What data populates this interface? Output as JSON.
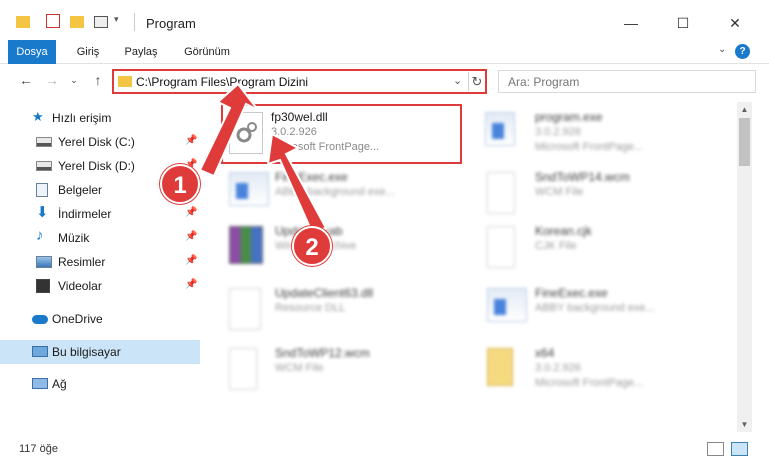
{
  "window": {
    "title": "Program"
  },
  "ribbon": {
    "tabs": [
      "Dosya",
      "Giriş",
      "Paylaş",
      "Görünüm"
    ]
  },
  "address": {
    "path": "C:\\Program Files\\Program Dizini"
  },
  "search": {
    "placeholder": "Ara: Program"
  },
  "sidebar": {
    "items": [
      {
        "label": "Hızlı erişim",
        "icon": "star-icon"
      },
      {
        "label": "Yerel Disk (C:)",
        "icon": "drive-icon",
        "pinned": true
      },
      {
        "label": "Yerel Disk (D:)",
        "icon": "drive-icon",
        "pinned": true
      },
      {
        "label": "Belgeler",
        "icon": "documents-icon",
        "pinned": true
      },
      {
        "label": "İndirmeler",
        "icon": "download-icon",
        "pinned": true
      },
      {
        "label": "Müzik",
        "icon": "music-icon",
        "pinned": true
      },
      {
        "label": "Resimler",
        "icon": "pictures-icon",
        "pinned": true
      },
      {
        "label": "Videolar",
        "icon": "video-icon",
        "pinned": true
      },
      {
        "label": "OneDrive",
        "icon": "cloud-icon"
      },
      {
        "label": "Bu bilgisayar",
        "icon": "computer-icon"
      },
      {
        "label": "Ağ",
        "icon": "network-icon"
      }
    ]
  },
  "files": [
    {
      "name": "fp30wel.dll",
      "line1": "3.0.2.926",
      "line2": "Microsoft FrontPage...",
      "icon": "dll-gear-icon"
    },
    {
      "name": "program.exe",
      "line1": "3.0.2.926",
      "line2": "Microsoft FrontPage...",
      "icon": "exe-icon"
    },
    {
      "name": "FineExec.exe",
      "line1": "ABBY background exe...",
      "line2": "",
      "icon": "app-icon"
    },
    {
      "name": "SndToWP14.wcm",
      "line1": "WCM File",
      "line2": "",
      "icon": "document-icon"
    },
    {
      "name": "Updates.cab",
      "line1": "WinRAR Archive",
      "line2": "",
      "icon": "archive-icon"
    },
    {
      "name": "Korean.cjk",
      "line1": "CJK File",
      "line2": "",
      "icon": "document-icon"
    },
    {
      "name": "UpdateClient63.dll",
      "line1": "Resource DLL",
      "line2": "",
      "icon": "dll-gear-icon"
    },
    {
      "name": "FineExec.exe",
      "line1": "ABBY background exe...",
      "line2": "",
      "icon": "app-icon"
    },
    {
      "name": "SndToWP12.wcm",
      "line1": "WCM File",
      "line2": "",
      "icon": "document-icon"
    },
    {
      "name": "x64",
      "line1": "3.0.2.926",
      "line2": "Microsoft FrontPage...",
      "icon": "zip-folder-icon"
    }
  ],
  "status": {
    "count": "117 öğe"
  },
  "callouts": [
    "1",
    "2"
  ],
  "colors": {
    "accent": "#1979ca",
    "highlight": "#e03b3b",
    "selected": "#cce4f7"
  }
}
